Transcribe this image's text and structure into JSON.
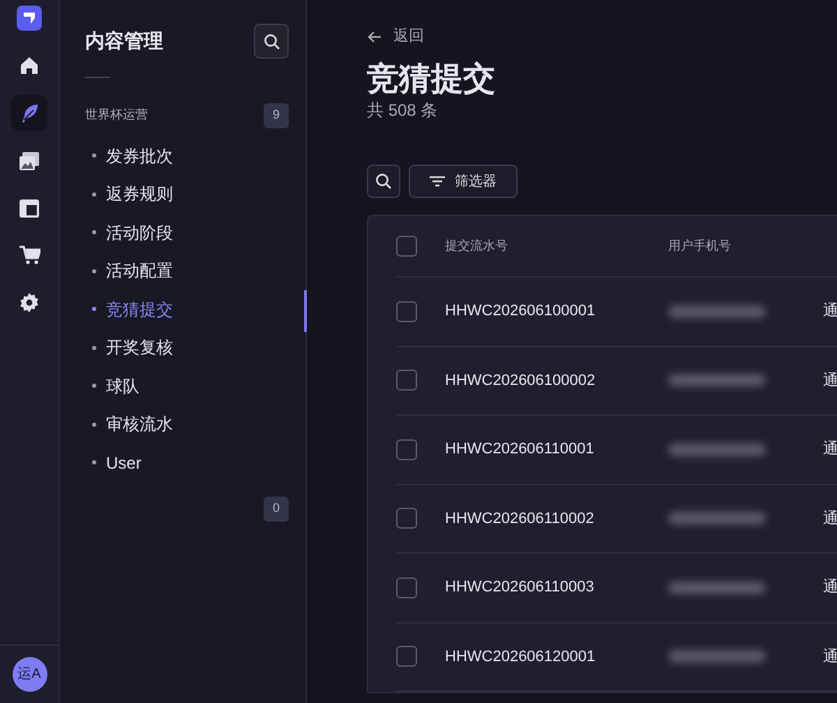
{
  "rail": {
    "items": [
      {
        "selected": false
      },
      {
        "selected": false
      },
      {
        "selected": true
      },
      {
        "selected": false
      },
      {
        "selected": false
      },
      {
        "selected": false
      },
      {
        "selected": false
      }
    ],
    "avatar": "运A"
  },
  "sidebar": {
    "title": "内容管理",
    "groups": [
      {
        "label": "世界杯运营",
        "count": "9",
        "items": [
          {
            "label": "发券批次",
            "selected": false
          },
          {
            "label": "返券规则",
            "selected": false
          },
          {
            "label": "活动阶段",
            "selected": false
          },
          {
            "label": "活动配置",
            "selected": false
          },
          {
            "label": "竞猜提交",
            "selected": true
          },
          {
            "label": "开奖复核",
            "selected": false
          },
          {
            "label": "球队",
            "selected": false
          },
          {
            "label": "审核流水",
            "selected": false
          },
          {
            "label": "User",
            "selected": false
          }
        ]
      },
      {
        "count": "0"
      }
    ]
  },
  "page": {
    "back": "返回",
    "title": "竞猜提交",
    "subtitle": "共 508 条",
    "filter_button": "筛选器"
  },
  "table": {
    "columns": [
      "提交流水号",
      "用户手机号"
    ],
    "all_checked": false,
    "rows": [
      {
        "serial": "HHWC202606100001",
        "checked": false,
        "column_3": "通"
      },
      {
        "serial": "HHWC202606100002",
        "checked": false,
        "column_3": "通"
      },
      {
        "serial": "HHWC202606110001",
        "checked": false,
        "column_3": "通"
      },
      {
        "serial": "HHWC202606110002",
        "checked": false,
        "column_3": "通"
      },
      {
        "serial": "HHWC202606110003",
        "checked": false,
        "column_3": "通"
      },
      {
        "serial": "HHWC202606120001",
        "checked": false,
        "column_3": "通"
      }
    ]
  }
}
